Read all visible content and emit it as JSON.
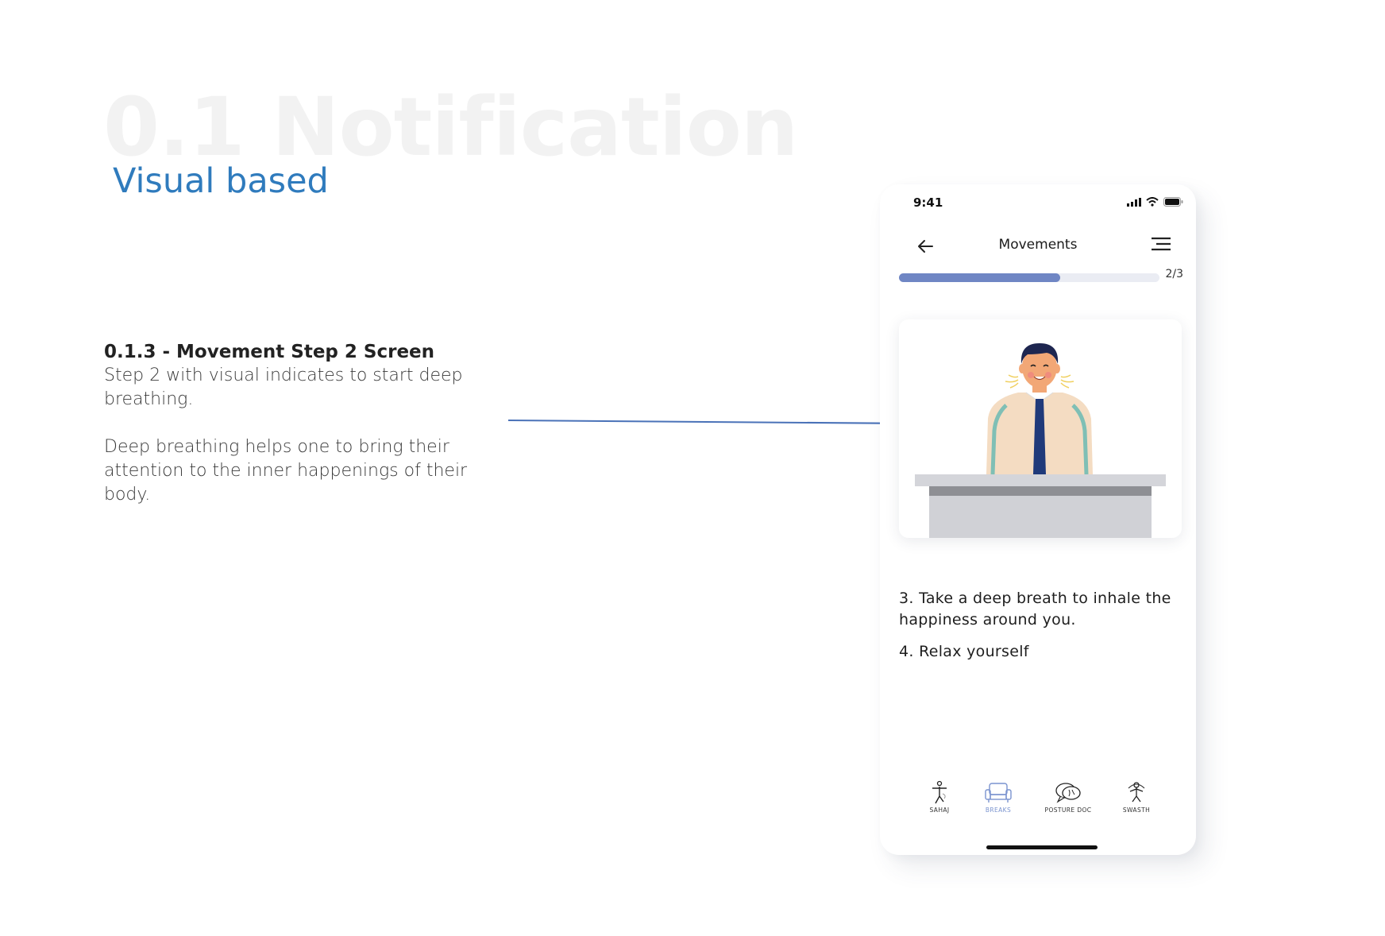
{
  "page": {
    "background_title": "0.1 Notification",
    "subtitle": "Visual based",
    "subtitle_color": "#2f7bbd"
  },
  "description": {
    "heading": "0.1.3 - Movement Step 2 Screen",
    "paragraphs": [
      "Step 2 with visual indicates  to start deep breathing.",
      "Deep breathing helps one to bring their attention to the inner happenings of their body."
    ]
  },
  "phone": {
    "status_bar": {
      "time": "9:41",
      "icons": [
        "cellular-signal-icon",
        "wifi-icon",
        "battery-icon"
      ]
    },
    "nav": {
      "title": "Movements",
      "back_icon": "back-arrow-icon",
      "menu_icon": "hamburger-menu-icon"
    },
    "progress": {
      "fraction": 0.62,
      "label": "2/3",
      "color": "#6f86c4"
    },
    "illustration": {
      "description_icon": "man-deep-breathing-at-desk-illustration"
    },
    "instructions": [
      "3. Take a deep breath to inhale the happiness around you.",
      "4. Relax yourself"
    ],
    "tabs": [
      {
        "label": "SAHAJ",
        "icon": "sahaj-figure-icon",
        "active": false
      },
      {
        "label": "BREAKS",
        "icon": "sofa-icon",
        "active": true
      },
      {
        "label": "POSTURE DOC",
        "icon": "posture-doc-chat-icon",
        "active": false
      },
      {
        "label": "SWASTH",
        "icon": "swasth-figure-icon",
        "active": false
      }
    ],
    "active_tab_color": "#7a93cf"
  }
}
